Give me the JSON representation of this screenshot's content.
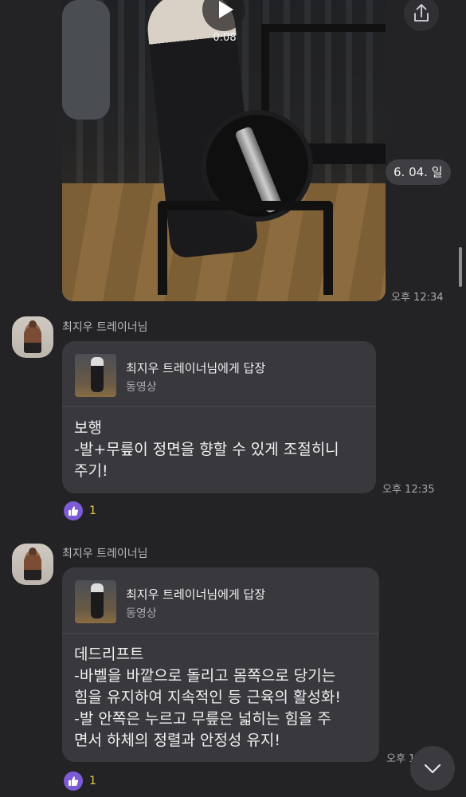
{
  "video_message": {
    "duration": "0:08",
    "time": "오후 12:34"
  },
  "date_divider": "6. 04. 일",
  "messages": [
    {
      "sender": "최지우 트레이너님",
      "reply_to": "최지우 트레이너님에게 답장",
      "reply_type": "동영상",
      "text": "보행\n-발+무릎이 정면을 향할 수 있게 조절히니\n주기!",
      "time": "오후 12:35",
      "reaction": {
        "icon": "thumbs-up-icon",
        "count": "1"
      }
    },
    {
      "sender": "최지우 트레이너님",
      "reply_to": "최지우 트레이너님에게 답장",
      "reply_type": "동영상",
      "text": "데드리프트\n-바벨을 바깥으로 돌리고 몸쪽으로 당기는\n힘을 유지하여 지속적인 등 근육의 활성화!\n-발 안쪽은 누르고 무릎은 넓히는 힘을 주\n면서 하체의 정렬과 안정성 유지!",
      "time": "오후 1",
      "reaction": {
        "icon": "thumbs-up-icon",
        "count": "1"
      }
    }
  ],
  "colors": {
    "background": "#232326",
    "bubble": "#38383d",
    "reaction": "#7e5bd6",
    "count": "#e8c84a"
  }
}
